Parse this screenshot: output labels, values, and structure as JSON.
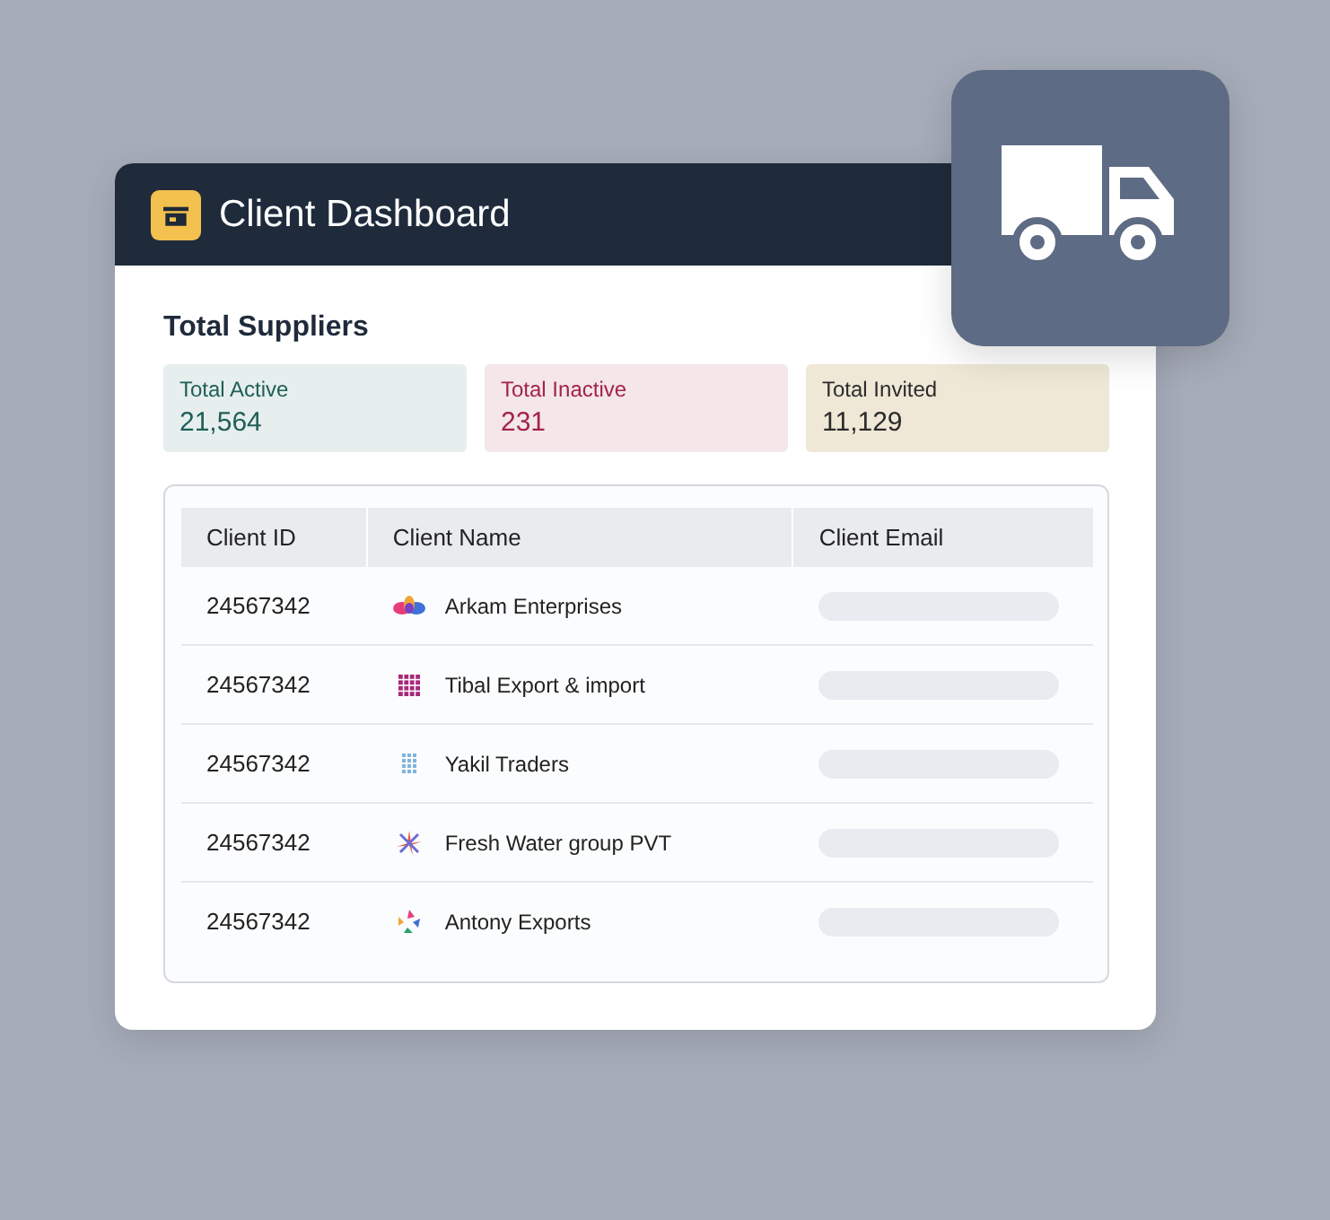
{
  "window": {
    "title": "Client Dashboard"
  },
  "section_title": "Total Suppliers",
  "stats": [
    {
      "label": "Total Active",
      "value": "21,564",
      "color": "#1f5f57"
    },
    {
      "label": "Total Inactive",
      "value": "231",
      "color": "#a3244a"
    },
    {
      "label": "Total Invited",
      "value": "11,129",
      "color": "#2b2b2b"
    }
  ],
  "table": {
    "columns": [
      "Client ID",
      "Client Name",
      "Client Email"
    ],
    "rows": [
      {
        "id": "24567342",
        "name": "Arkam Enterprises"
      },
      {
        "id": "24567342",
        "name": "Tibal Export & import"
      },
      {
        "id": "24567342",
        "name": "Yakil Traders"
      },
      {
        "id": "24567342",
        "name": "Fresh Water group PVT"
      },
      {
        "id": "24567342",
        "name": "Antony Exports"
      }
    ]
  }
}
